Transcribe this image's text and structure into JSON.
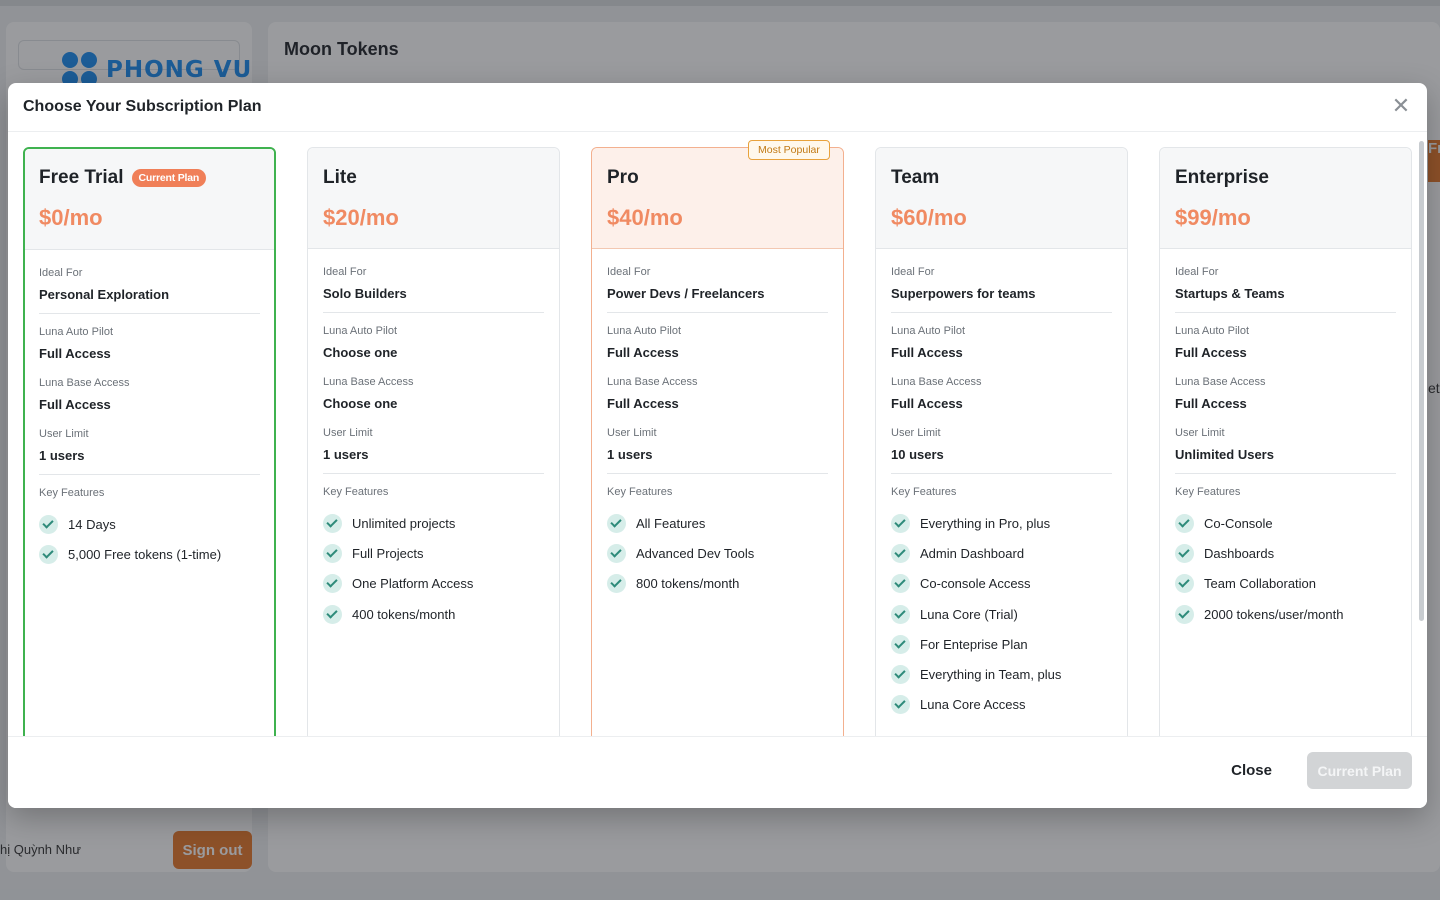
{
  "background": {
    "app_title": "Moon Tokens",
    "logo_text": "PHONG VU",
    "user_name": "hị Quỳnh Như",
    "sign_out_label": "Sign out",
    "edge_text": "et",
    "edge_accent_text": "Fr"
  },
  "modal": {
    "title": "Choose Your Subscription Plan",
    "close_glyph": "✕",
    "labels": {
      "ideal_for": "Ideal For",
      "auto_pilot": "Luna Auto Pilot",
      "base_access": "Luna Base Access",
      "user_limit": "User Limit",
      "key_features": "Key Features"
    },
    "plans": [
      {
        "name": "Free Trial",
        "badge": "Current Plan",
        "price": "$0/mo",
        "ideal_for": "Personal Exploration",
        "auto_pilot": "Full Access",
        "base_access": "Full Access",
        "user_limit": "1 users",
        "features": [
          "14 Days",
          "5,000 Free tokens (1-time)"
        ]
      },
      {
        "name": "Lite",
        "price": "$20/mo",
        "ideal_for": "Solo Builders",
        "auto_pilot": "Choose one",
        "base_access": "Choose one",
        "user_limit": "1 users",
        "features": [
          "Unlimited projects",
          "Full Projects",
          "One Platform Access",
          "400 tokens/month"
        ]
      },
      {
        "name": "Pro",
        "badge": "Most Popular",
        "price": "$40/mo",
        "ideal_for": "Power Devs / Freelancers",
        "auto_pilot": "Full Access",
        "base_access": "Full Access",
        "user_limit": "1 users",
        "features": [
          "All Features",
          "Advanced Dev Tools",
          "800 tokens/month"
        ]
      },
      {
        "name": "Team",
        "price": "$60/mo",
        "ideal_for": "Superpowers for teams",
        "auto_pilot": "Full Access",
        "base_access": "Full Access",
        "user_limit": "10 users",
        "features": [
          "Everything in Pro, plus",
          "Admin Dashboard",
          "Co-console Access",
          "Luna Core (Trial)",
          "For Enteprise Plan",
          "Everything in Team, plus",
          "Luna Core Access"
        ]
      },
      {
        "name": "Enterprise",
        "price": "$99/mo",
        "ideal_for": "Startups & Teams",
        "auto_pilot": "Full Access",
        "base_access": "Full Access",
        "user_limit": "Unlimited Users",
        "features": [
          "Co-Console",
          "Dashboards",
          "Team Collaboration",
          "2000 tokens/user/month"
        ]
      }
    ],
    "footer": {
      "close_label": "Close",
      "current_plan_label": "Current Plan"
    }
  },
  "colors": {
    "price": "#f08a62",
    "current_border": "#3fb24f",
    "popular_border": "#f3b08f",
    "check_bg": "#d6ede9",
    "check_mark": "#2e8b7a",
    "sign_out": "#e8782a"
  },
  "icons": {
    "feature": "check-icon",
    "close": "close-icon",
    "logo": "logo-dots-icon"
  }
}
